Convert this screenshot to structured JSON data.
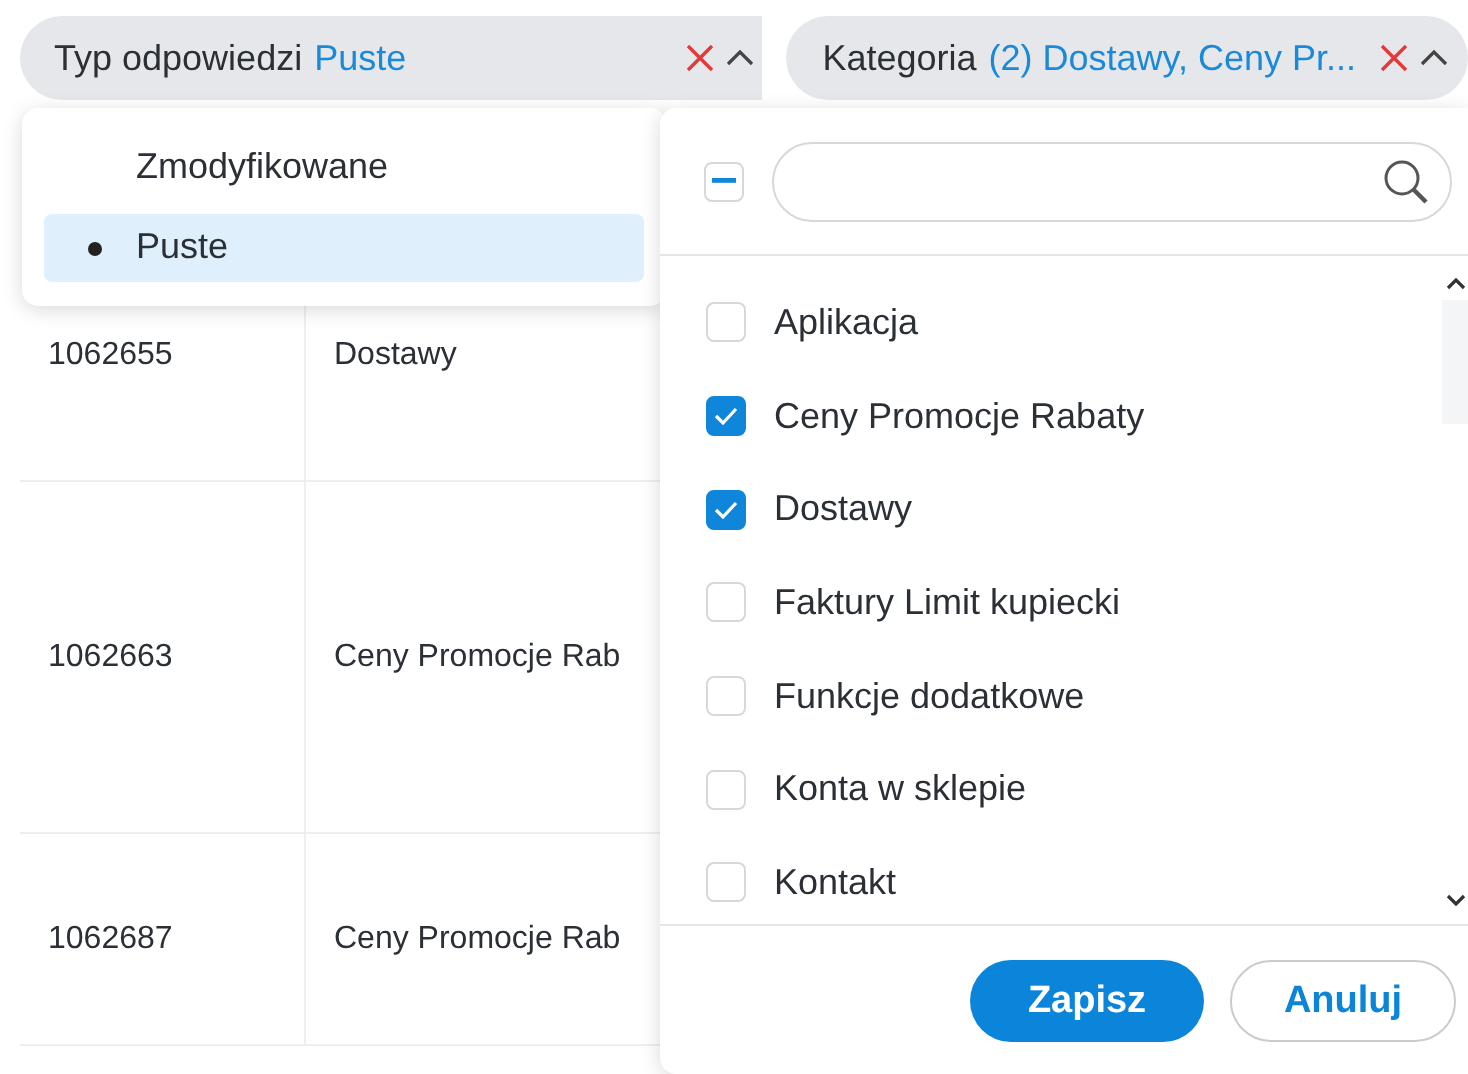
{
  "filters": [
    {
      "label": "Typ odpowiedzi",
      "value": "Puste",
      "expanded": true
    },
    {
      "label": "Kategoria",
      "value": "(2) Dostawy, Ceny Pr...",
      "expanded": true
    }
  ],
  "response_type_menu": {
    "options": [
      {
        "label": "Zmodyfikowane",
        "selected": false
      },
      {
        "label": "Puste",
        "selected": true
      }
    ]
  },
  "category_menu": {
    "select_all": {
      "indeterminate": true
    },
    "options": [
      {
        "label": "Aplikacja",
        "checked": false
      },
      {
        "label": "Ceny Promocje Rabaty",
        "checked": true
      },
      {
        "label": "Dostawy",
        "checked": true
      },
      {
        "label": "Faktury Limit kupiecki",
        "checked": false
      },
      {
        "label": "Funkcje dodatkowe",
        "checked": false
      },
      {
        "label": "Konta w sklepie",
        "checked": false
      },
      {
        "label": "Kontakt",
        "checked": false
      }
    ],
    "buttons": [
      {
        "label": "Zapisz",
        "kind": "primary"
      },
      {
        "label": "Anuluj",
        "kind": "secondary"
      }
    ]
  },
  "table": {
    "rows": [
      {
        "column_1": "1062655",
        "column_2": "Dostawy"
      },
      {
        "column_1": "1062663",
        "column_2": "Ceny Promocje Rab"
      },
      {
        "column_1": "1062687",
        "column_2": "Ceny Promocje Rab"
      }
    ]
  }
}
